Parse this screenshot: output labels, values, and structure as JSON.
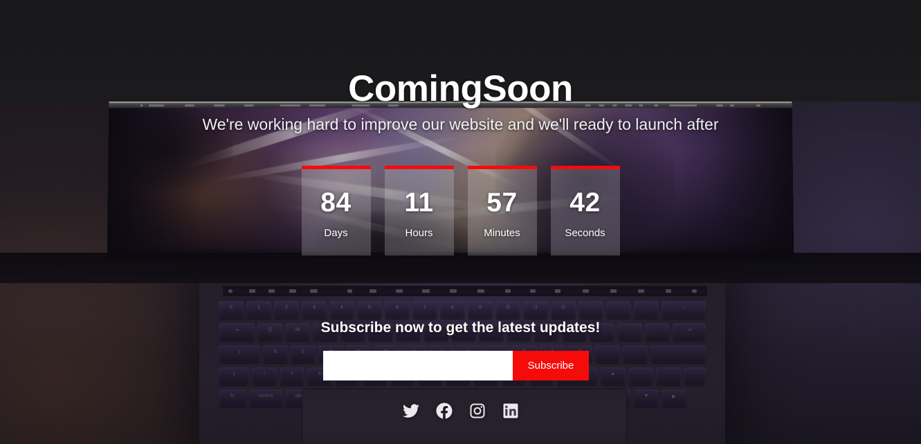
{
  "page": {
    "title": "ComingSoon",
    "subtitle": "We're working hard to improve our website and we'll ready to launch after"
  },
  "countdown": {
    "items": [
      {
        "value": "84",
        "label": "Days"
      },
      {
        "value": "11",
        "label": "Hours"
      },
      {
        "value": "57",
        "label": "Minutes"
      },
      {
        "value": "42",
        "label": "Seconds"
      }
    ],
    "accent_color": "#f60b0b"
  },
  "subscribe": {
    "heading": "Subscribe now to get the latest updates!",
    "input_value": "",
    "input_placeholder": "",
    "button_label": "Subscribe",
    "button_color": "#f60b0b"
  },
  "social": {
    "items": [
      {
        "name": "twitter-icon"
      },
      {
        "name": "facebook-icon"
      },
      {
        "name": "instagram-icon"
      },
      {
        "name": "linkedin-icon"
      }
    ]
  },
  "theme": {
    "background_color": "#1d1c1e",
    "text_color": "#ffffff",
    "accent_color": "#f60b0b"
  }
}
